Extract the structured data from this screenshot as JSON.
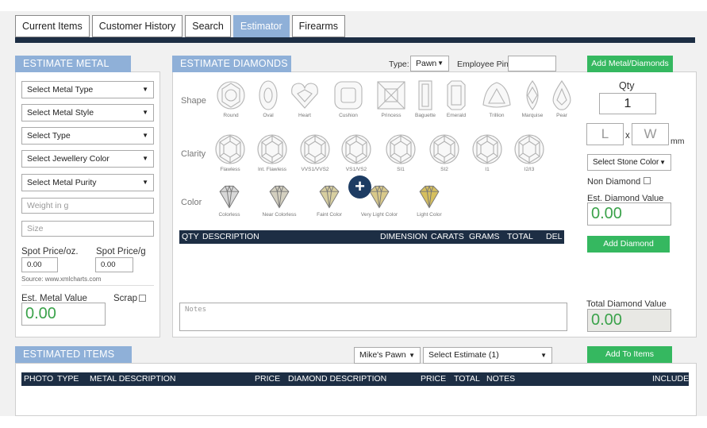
{
  "tabs": [
    {
      "label": "Current Items"
    },
    {
      "label": "Customer History"
    },
    {
      "label": "Search"
    },
    {
      "label": "Estimator"
    },
    {
      "label": "Firearms"
    }
  ],
  "metal": {
    "title": "ESTIMATE METAL",
    "selects": [
      "Select Metal Type",
      "Select Metal Style",
      "Select Type",
      "Select Jewellery Color",
      "Select Metal Purity"
    ],
    "weight_placeholder": "Weight in g",
    "size_placeholder": "Size",
    "spot_oz_label": "Spot Price/oz.",
    "spot_oz_value": "0.00",
    "spot_g_label": "Spot Price/g",
    "spot_g_value": "0.00",
    "source": "Source: www.xmlcharts.com",
    "est_label": "Est. Metal Value",
    "scrap_label": "Scrap",
    "est_value": "0.00"
  },
  "diamonds": {
    "title": "ESTIMATE DIAMONDS",
    "type_label": "Type:",
    "type_value": "Pawn",
    "pin_label": "Employee Pin:",
    "shape_label": "Shape",
    "clarity_label": "Clarity",
    "color_label": "Color",
    "shapes": [
      "Round",
      "Oval",
      "Heart",
      "Cushion",
      "Princess",
      "Baguette",
      "Emerald",
      "Trillion",
      "Marquise",
      "Pear"
    ],
    "clarities": [
      "Flawless",
      "Int. Flawless",
      "VVS1/VVS2",
      "VS1/VS2",
      "SI1",
      "SI2",
      "I1",
      "I2/I3"
    ],
    "colors": [
      {
        "name": "Colorless",
        "hex": "#d8d8d8"
      },
      {
        "name": "Near Colorless",
        "hex": "#d4d0c0"
      },
      {
        "name": "Faint Color",
        "hex": "#d8cfa0"
      },
      {
        "name": "Very Light Color",
        "hex": "#d9c98a"
      },
      {
        "name": "Light Color",
        "hex": "#d6bf5e"
      }
    ],
    "table_headers": [
      "QTY",
      "DESCRIPTION",
      "DIMENSION",
      "CARATS",
      "GRAMS",
      "TOTAL",
      "DEL"
    ],
    "notes_placeholder": "Notes"
  },
  "right": {
    "add_metal_btn": "Add Metal/Diamonds",
    "qty_label": "Qty",
    "qty_value": "1",
    "l_placeholder": "L",
    "x_label": "x",
    "w_placeholder": "W",
    "mm_label": "mm",
    "stone_color": "Select Stone Color",
    "non_diamond_label": "Non Diamond",
    "est_diamond_label": "Est. Diamond Value",
    "est_diamond_value": "0.00",
    "add_diamond_btn": "Add Diamond",
    "total_diamond_label": "Total Diamond Value",
    "total_diamond_value": "0.00"
  },
  "estimated": {
    "title": "ESTIMATED ITEMS",
    "store": "Mike's Pawn",
    "estimate": "Select Estimate (1)",
    "add_btn": "Add To Items",
    "headers": [
      "PHOTO",
      "TYPE",
      "METAL DESCRIPTION",
      "PRICE",
      "DIAMOND DESCRIPTION",
      "PRICE",
      "TOTAL",
      "NOTES",
      "INCLUDE"
    ]
  },
  "colors": {
    "accent": "#8fb0d8",
    "navy": "#1d2e44",
    "green": "#35b860",
    "value_green": "#3aa24a"
  }
}
